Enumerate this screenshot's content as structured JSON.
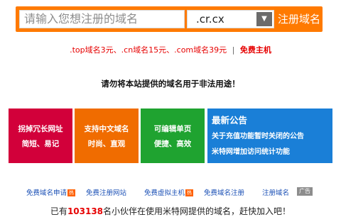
{
  "search": {
    "placeholder": "请输入您想注册的域名",
    "tld_selected": ".cr.cx",
    "submit_label": "注册域名"
  },
  "promo": {
    "text": ".top域名3元、.cn域名15元、.com域名39元",
    "separator": "|",
    "host_label": "免费主机"
  },
  "warning": "请勿将本站提供的域名用于非法用途！",
  "tiles": [
    {
      "line1": "拐掉冗长网址",
      "line2": "简短、易记"
    },
    {
      "line1": "支持中文域名",
      "line2": "时尚、直观"
    },
    {
      "line1": "可编辑单页",
      "line2": "便捷、高效"
    }
  ],
  "news": {
    "title": "最新公告",
    "items": [
      "关于充值功能暂时关闭的公告",
      "米特网增加访问统计功能"
    ]
  },
  "links": [
    {
      "label": "免费域名申请",
      "badge": "热"
    },
    {
      "label": "免费注册网站"
    },
    {
      "label": "免费虚拟主机",
      "badge": "热"
    },
    {
      "label": "免费域名注册"
    },
    {
      "label": "注册域名"
    }
  ],
  "ad_label": "广告",
  "count_line": {
    "prefix": "已有",
    "count": "103138",
    "suffix": "名小伙伴在使用米特网提供的域名，赶快加入吧！"
  },
  "colors": {
    "accent": "#ff7a00",
    "promo_red": "#e60000",
    "tile_red": "#d2003a",
    "tile_orange": "#f06c00",
    "tile_green": "#1fa330",
    "tile_blue": "#1a7fd7",
    "link_blue": "#1a4fb5"
  }
}
